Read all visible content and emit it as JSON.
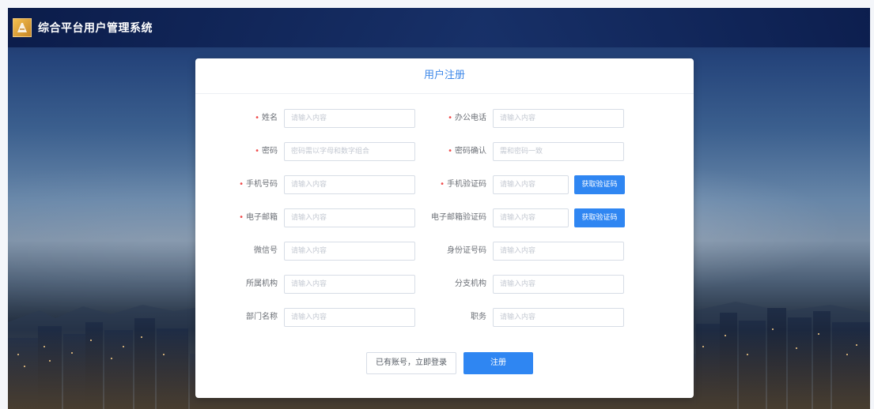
{
  "header": {
    "title": "综合平台用户管理系统"
  },
  "card": {
    "title": "用户注册"
  },
  "rows": [
    {
      "left": {
        "label": "姓名",
        "required": true,
        "placeholder": "请输入内容"
      },
      "right": {
        "label": "办公电话",
        "required": true,
        "placeholder": "请输入内容"
      }
    },
    {
      "left": {
        "label": "密码",
        "required": true,
        "placeholder": "密码需以字母和数字组合"
      },
      "right": {
        "label": "密码确认",
        "required": true,
        "placeholder": "需和密码一致"
      }
    },
    {
      "left": {
        "label": "手机号码",
        "required": true,
        "placeholder": "请输入内容"
      },
      "right": {
        "label": "手机验证码",
        "required": true,
        "placeholder": "请输入内容",
        "button": "获取验证码"
      }
    },
    {
      "left": {
        "label": "电子邮箱",
        "required": true,
        "placeholder": "请输入内容"
      },
      "right": {
        "label": "电子邮箱验证码",
        "required": false,
        "placeholder": "请输入内容",
        "button": "获取验证码"
      }
    },
    {
      "left": {
        "label": "微信号",
        "required": false,
        "placeholder": "请输入内容"
      },
      "right": {
        "label": "身份证号码",
        "required": false,
        "placeholder": "请输入内容"
      }
    },
    {
      "left": {
        "label": "所属机构",
        "required": false,
        "placeholder": "请输入内容"
      },
      "right": {
        "label": "分支机构",
        "required": false,
        "placeholder": "请输入内容"
      }
    },
    {
      "left": {
        "label": "部门名称",
        "required": false,
        "placeholder": "请输入内容"
      },
      "right": {
        "label": "职务",
        "required": false,
        "placeholder": "请输入内容"
      }
    }
  ],
  "actions": {
    "login_label": "已有账号，立即登录",
    "register_label": "注册"
  },
  "colors": {
    "accent": "#2f86f2",
    "required": "#f04a4a",
    "header_bg": "#102a6a"
  },
  "icons": {
    "logo": "logo-icon"
  }
}
